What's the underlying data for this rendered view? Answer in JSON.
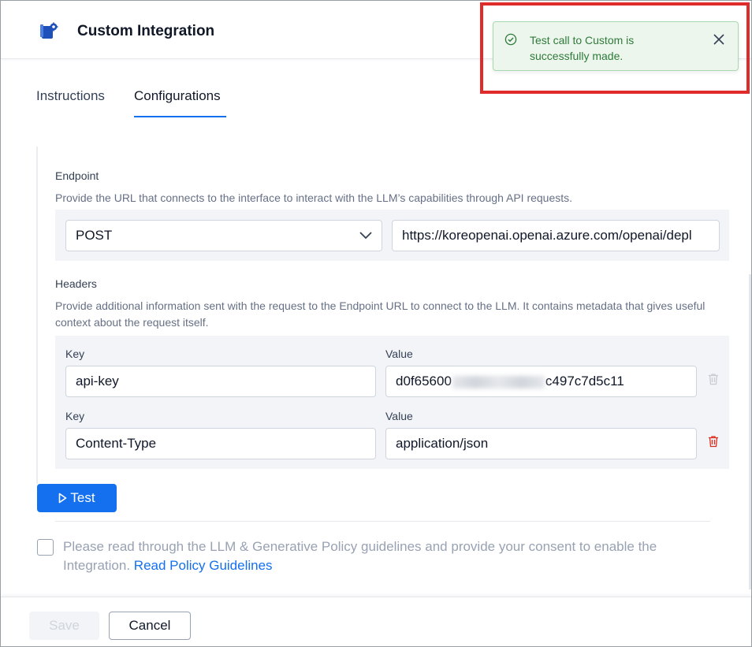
{
  "header": {
    "title": "Custom Integration"
  },
  "tabs": [
    {
      "label": "Instructions",
      "active": false
    },
    {
      "label": "Configurations",
      "active": true
    }
  ],
  "endpoint": {
    "title": "Endpoint",
    "description": "Provide the URL that connects to the interface to interact with the LLM’s capabilities through API requests.",
    "method": "POST",
    "url": "https://koreopenai.openai.azure.com/openai/depl"
  },
  "headers": {
    "title": "Headers",
    "description": "Provide additional information sent with the request to the Endpoint URL to connect to the LLM. It contains metadata that gives useful context about the request itself.",
    "rows": [
      {
        "key_label": "Key",
        "value_label": "Value",
        "key": "api-key",
        "value_prefix": "d0f65600",
        "value_suffix": "c497c7d5c11"
      },
      {
        "key_label": "Key",
        "value_label": "Value",
        "key": "Content-Type",
        "value": "application/json"
      }
    ]
  },
  "test_button": {
    "label": "Test"
  },
  "consent": {
    "text": "Please read through the LLM & Generative Policy guidelines and provide your consent to enable the Integration.",
    "link": "Read Policy Guidelines"
  },
  "footer": {
    "save_label": "Save",
    "cancel_label": "Cancel"
  },
  "toast": {
    "message": "Test call to Custom is successfully made.",
    "status": "success"
  },
  "colors": {
    "accent": "#1570ef",
    "success_bg": "#ecf6ed",
    "success_text": "#2f7a3a",
    "highlight": "#e02b2b",
    "delete": "#d92d20"
  }
}
